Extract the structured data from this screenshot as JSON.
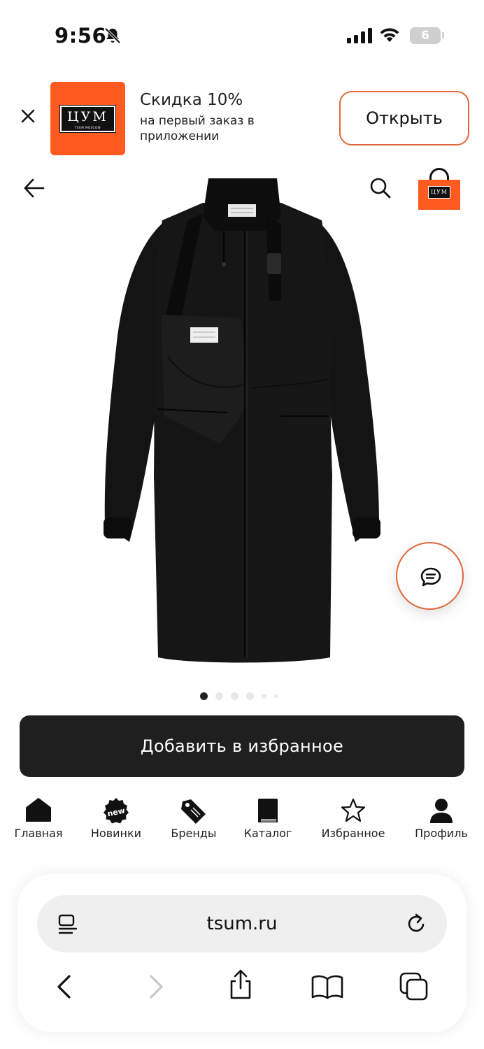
{
  "status_bar": {
    "time": "9:56",
    "battery": "6"
  },
  "banner": {
    "logo_text": "ЦУМ",
    "logo_subtext": "TSUM MOSCOW",
    "title": "Скидка 10%",
    "subtitle": "на первый заказ в приложении",
    "open_label": "Открыть"
  },
  "product": {
    "image_pages": 6,
    "current_page": 1
  },
  "favorites_button": {
    "label": "Добавить в избранное"
  },
  "tabbar": {
    "items": [
      {
        "label": "Главная",
        "icon": "home-icon"
      },
      {
        "label": "Новинки",
        "icon": "new-badge-icon",
        "badge": "new"
      },
      {
        "label": "Бренды",
        "icon": "tag-icon"
      },
      {
        "label": "Каталог",
        "icon": "book-icon"
      },
      {
        "label": "Избранное",
        "icon": "star-icon"
      },
      {
        "label": "Профиль",
        "icon": "profile-icon"
      }
    ]
  },
  "browser": {
    "url": "tsum.ru"
  },
  "colors": {
    "accent": "#ff5a1f",
    "button_dark": "#1f1f1f"
  }
}
